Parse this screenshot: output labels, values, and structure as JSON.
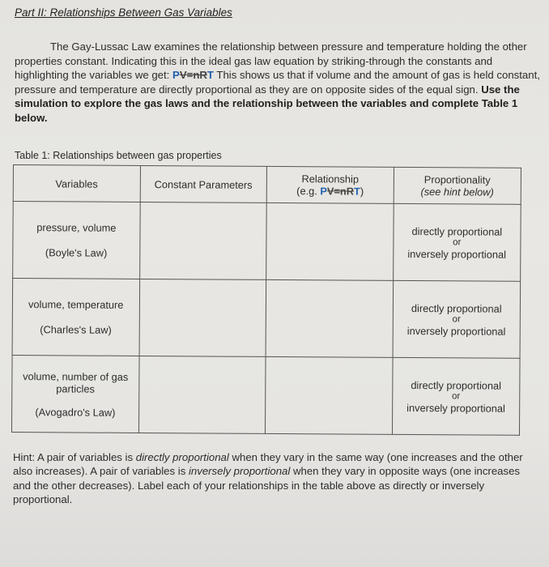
{
  "section": {
    "title": "Part II:  Relationships Between Gas Variables"
  },
  "intro": {
    "text_before_eq": "The Gay-Lussac Law examines the relationship between pressure and temperature holding the other properties constant.  Indicating this in the ideal gas law equation by striking-through the constants and highlighting the variables we get: ",
    "equation": {
      "P": "P",
      "V": "V",
      "eq": "=",
      "n": "n",
      "R": "R",
      "T": "T"
    },
    "text_after_eq": "  This shows us that if volume and the amount of gas is held constant, pressure and temperature are directly proportional as they are on opposite sides of the equal sign. ",
    "instruction_bold": "Use the simulation to explore the gas laws and the relationship between the variables and complete Table 1 below."
  },
  "table": {
    "caption": "Table 1: Relationships between gas properties",
    "headers": {
      "variables": "Variables",
      "constants": "Constant Parameters",
      "relationship": "Relationship",
      "relationship_example_prefix": "(e.g. ",
      "relationship_example_suffix": ")",
      "proportionality": "Proportionality",
      "proportionality_note": "(see hint below)"
    },
    "rows": [
      {
        "variables": "pressure, volume",
        "law": "(Boyle's Law)",
        "constants": "",
        "relationship": "",
        "prop_option_1": "directly proportional",
        "prop_or": "or",
        "prop_option_2": "inversely proportional"
      },
      {
        "variables": "volume, temperature",
        "law": "(Charles's Law)",
        "constants": "",
        "relationship": "",
        "prop_option_1": "directly proportional",
        "prop_or": "or",
        "prop_option_2": "inversely proportional"
      },
      {
        "variables": "volume, number of gas particles",
        "law": "(Avogadro's Law)",
        "constants": "",
        "relationship": "",
        "prop_option_1": "directly proportional",
        "prop_or": "or",
        "prop_option_2": "inversely proportional"
      }
    ]
  },
  "hint": {
    "prefix": "Hint: A pair of variables is ",
    "term_direct": "directly proportional",
    "mid1": " when they vary in the same way (one increases and the other also increases).  A pair of variables is ",
    "term_inverse": "inversely proportional",
    "mid2": " when they vary in opposite ways (one increases and the other decreases).  Label each of your relationships in the table above as directly or inversely proportional."
  },
  "colors": {
    "variable_highlight": "#1f5fae",
    "constant_strike": "#444444"
  }
}
